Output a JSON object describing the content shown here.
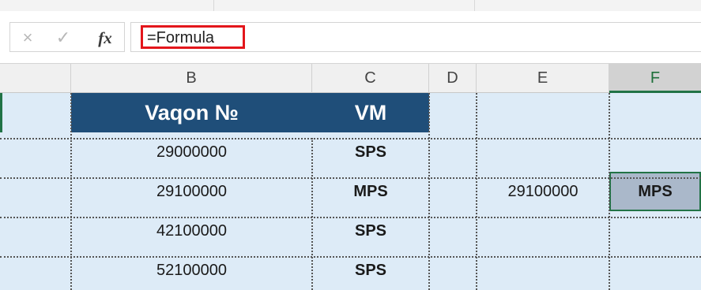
{
  "formula_bar": {
    "cancel_icon": "×",
    "enter_icon": "✓",
    "fx_label": "fx",
    "formula_text": "=Formula"
  },
  "columns": [
    {
      "id": "row-header",
      "label": ""
    },
    {
      "id": "B",
      "label": "B"
    },
    {
      "id": "C",
      "label": "C"
    },
    {
      "id": "D",
      "label": "D"
    },
    {
      "id": "E",
      "label": "E"
    },
    {
      "id": "F",
      "label": "F"
    }
  ],
  "table": {
    "header": {
      "vaqon": "Vaqon №",
      "vm": "VM"
    },
    "rows": [
      {
        "vaqon": "29000000",
        "vm": "SPS"
      },
      {
        "vaqon": "29100000",
        "vm": "MPS"
      },
      {
        "vaqon": "42100000",
        "vm": "SPS"
      },
      {
        "vaqon": "52100000",
        "vm": "SPS"
      }
    ]
  },
  "lookup": {
    "input": "29100000",
    "result": "MPS"
  },
  "colors": {
    "header_fill": "#1f4e79",
    "cell_fill": "#ddebf7",
    "selection": "#217346",
    "highlight_box": "#e3161b"
  }
}
